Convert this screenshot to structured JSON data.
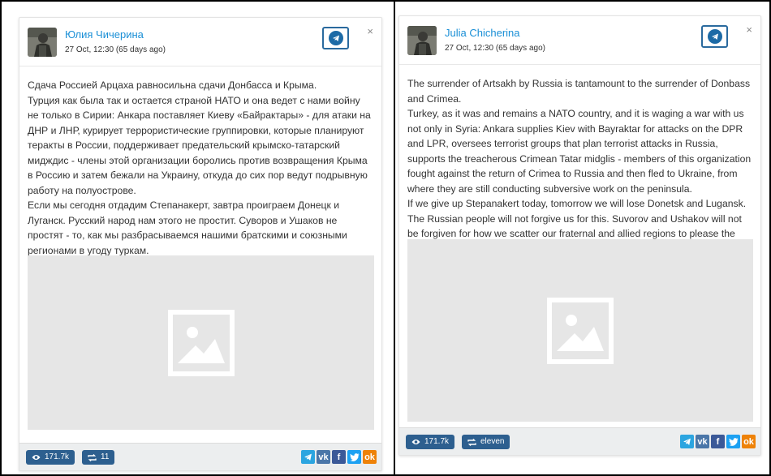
{
  "colors": {
    "author_link": "#1a8fd6",
    "pill_bg": "#2d5f8f",
    "telegram": "#2ca5e0",
    "vk": "#4a76a8",
    "facebook": "#3b5998",
    "twitter": "#1da1f2",
    "odnoklassniki": "#ee8208"
  },
  "left_post": {
    "author": "Юлия Чичерина",
    "meta": "27 Oct, 12:30 (65 days ago)",
    "close_label": "×",
    "paragraphs": [
      "Сдача Россией Арцаха равносильна сдачи Донбасса и Крыма.",
      "Турция как была так и остается страной НАТО и она ведет с нами войну не только в Сирии: Анкара поставляет Киеву «Байрактары» - для атаки на ДНР и ЛНР, курирует террористические группировки, которые планируют теракты в России, поддерживает предательский крымско-татарский мидждис - члены этой организации боролись против возвращения Крыма в Россию и затем бежали на Украину, откуда до сих пор ведут подрывную работу на полуострове.",
      "Если мы сегодня отдадим Степанакерт, завтра проиграем Донецк и Луганск. Русский народ нам этого не простит. Суворов и Ушаков не простят - то, как мы разбрасываемся нашими братскими и союзными регионами в угоду туркам."
    ],
    "views": "171.7k",
    "reposts": "11",
    "share_icons": [
      "telegram-icon",
      "vk-icon",
      "facebook-icon",
      "twitter-icon",
      "odnoklassniki-icon"
    ]
  },
  "right_post": {
    "author": "Julia Chicherina",
    "meta": "27 Oct, 12:30 (65 days ago)",
    "close_label": "×",
    "paragraphs": [
      "The surrender of Artsakh by Russia is tantamount to the surrender of Donbass and Crimea.",
      "Turkey, as it was and remains a NATO country, and it is waging a war with us not only in Syria: Ankara supplies Kiev with Bayraktar for attacks on the DPR and LPR, oversees terrorist groups that plan terrorist attacks in Russia, supports the treacherous Crimean Tatar midglis - members of this organization fought against the return of Crimea to Russia and then fled to Ukraine, from where they are still conducting subversive work on the peninsula.",
      "If we give up Stepanakert today, tomorrow we will lose Donetsk and Lugansk. The Russian people will not forgive us for this. Suvorov and Ushakov will not be forgiven for how we scatter our fraternal and allied regions to please the Turks."
    ],
    "views": "171.7k",
    "reposts": "eleven",
    "share_icons": [
      "telegram-icon",
      "vk-icon",
      "facebook-icon",
      "twitter-icon",
      "odnoklassniki-icon"
    ]
  },
  "share_glyphs": {
    "vk": "vk",
    "facebook": "f",
    "odnoklassniki": "ok"
  }
}
